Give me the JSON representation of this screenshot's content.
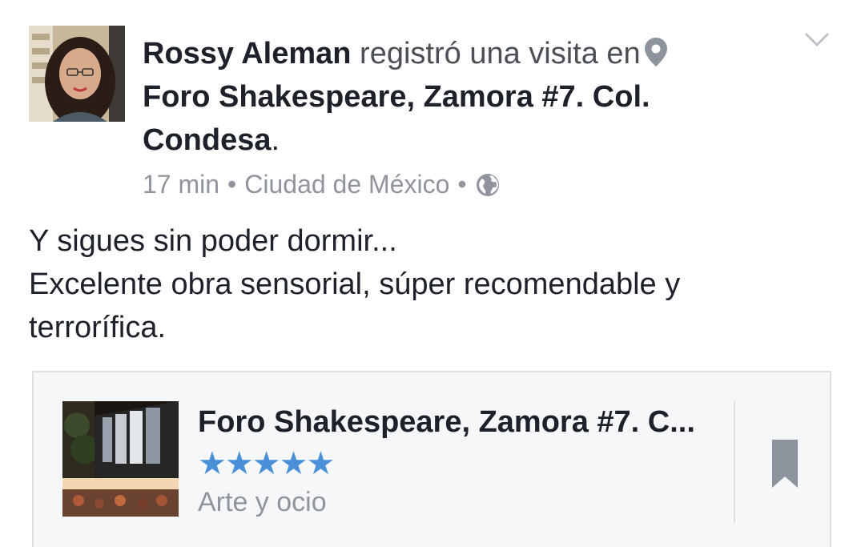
{
  "post": {
    "author": "Rossy Aleman",
    "verb": "registró una visita en",
    "place": "Foro Shakespeare, Zamora #7. Col. Condesa",
    "place_suffix": ".",
    "time": "17 min",
    "separator": "•",
    "location": "Ciudad de México",
    "privacy_icon": "globe-icon",
    "pin_icon": "location-pin-icon",
    "menu_icon": "chevron-down-icon",
    "text_lines": [
      "Y sigues sin poder dormir...",
      "Excelente obra sensorial, súper recomendable y",
      "terrorífica."
    ]
  },
  "card": {
    "title": "Foro Shakespeare, Zamora #7. C...",
    "rating_stars": 5,
    "stars_text": "★★★★★",
    "category": "Arte y ocio",
    "bookmark_icon": "bookmark-icon"
  },
  "colors": {
    "text_primary": "#1d2129",
    "text_secondary": "#90949c",
    "star_blue": "#4a90d9",
    "card_bg": "#f6f7f9",
    "border": "#dddfe2"
  }
}
